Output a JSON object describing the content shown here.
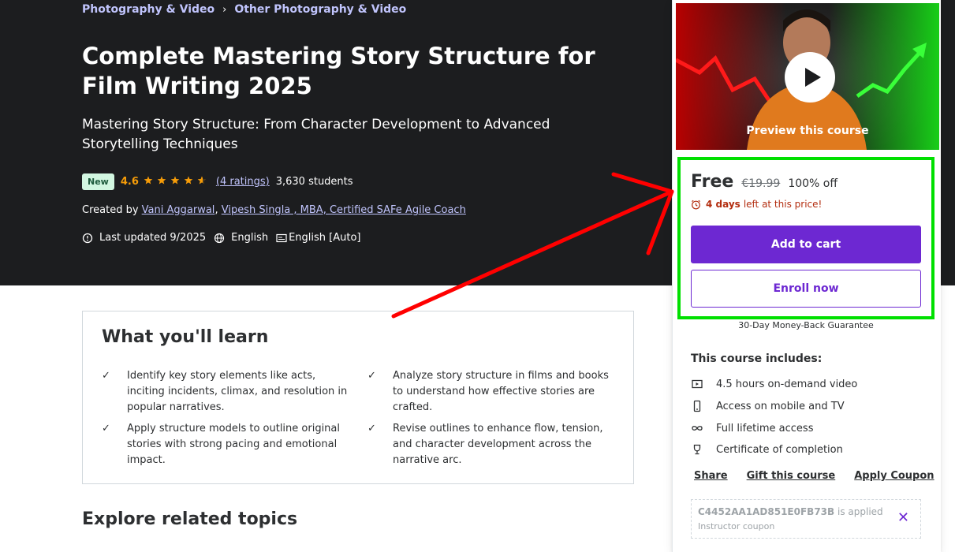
{
  "breadcrumb": {
    "items": [
      "Photography & Video",
      "Other Photography & Video"
    ],
    "separator": "›"
  },
  "course": {
    "title": "Complete Mastering Story Structure for Film Writing 2025",
    "subtitle": "Mastering Story Structure: From Character Development to Advanced Storytelling Techniques",
    "badge": "New",
    "rating": "4.6",
    "rating_fraction": 0.92,
    "ratings_link": "(4 ratings)",
    "students": "3,630 students",
    "created_by_label": "Created by",
    "instructors": [
      "Vani Aggarwal",
      "Vipesh Singla , MBA, Certified SAFe Agile Coach"
    ],
    "instructor_separator": ",",
    "last_updated": "Last updated 9/2025",
    "language": "English",
    "captions": "English [Auto]"
  },
  "learn": {
    "title": "What you'll learn",
    "items": [
      "Identify key story elements like acts, inciting incidents, climax, and resolution in popular narratives.",
      "Analyze story structure in films and books to understand how effective stories are crafted.",
      "Apply structure models to outline original stories with strong pacing and emotional impact.",
      "Revise outlines to enhance flow, tension, and character development across the narrative arc."
    ]
  },
  "explore": {
    "title": "Explore related topics"
  },
  "sidebar": {
    "preview_label": "Preview this course",
    "price": "Free",
    "original_price": "€19.99",
    "discount": "100% off",
    "timer_days": "4 days",
    "timer_rest": "left at this price!",
    "add_to_cart": "Add to cart",
    "enroll_now": "Enroll now",
    "guarantee": "30-Day Money-Back Guarantee",
    "includes_title": "This course includes:",
    "includes": [
      {
        "icon": "video-icon",
        "label": "4.5 hours on-demand video"
      },
      {
        "icon": "mobile-icon",
        "label": "Access on mobile and TV"
      },
      {
        "icon": "infinity-icon",
        "label": "Full lifetime access"
      },
      {
        "icon": "trophy-icon",
        "label": "Certificate of completion"
      }
    ],
    "links": [
      "Share",
      "Gift this course",
      "Apply Coupon"
    ],
    "coupon_code": "C4452AA1AD851E0FB73B",
    "coupon_applied": "is applied",
    "coupon_sub": "Instructor coupon"
  },
  "colors": {
    "accent": "#6d28d2",
    "highlight_box": "#00e000",
    "arrow": "#ff0000",
    "star": "#f69c08"
  }
}
